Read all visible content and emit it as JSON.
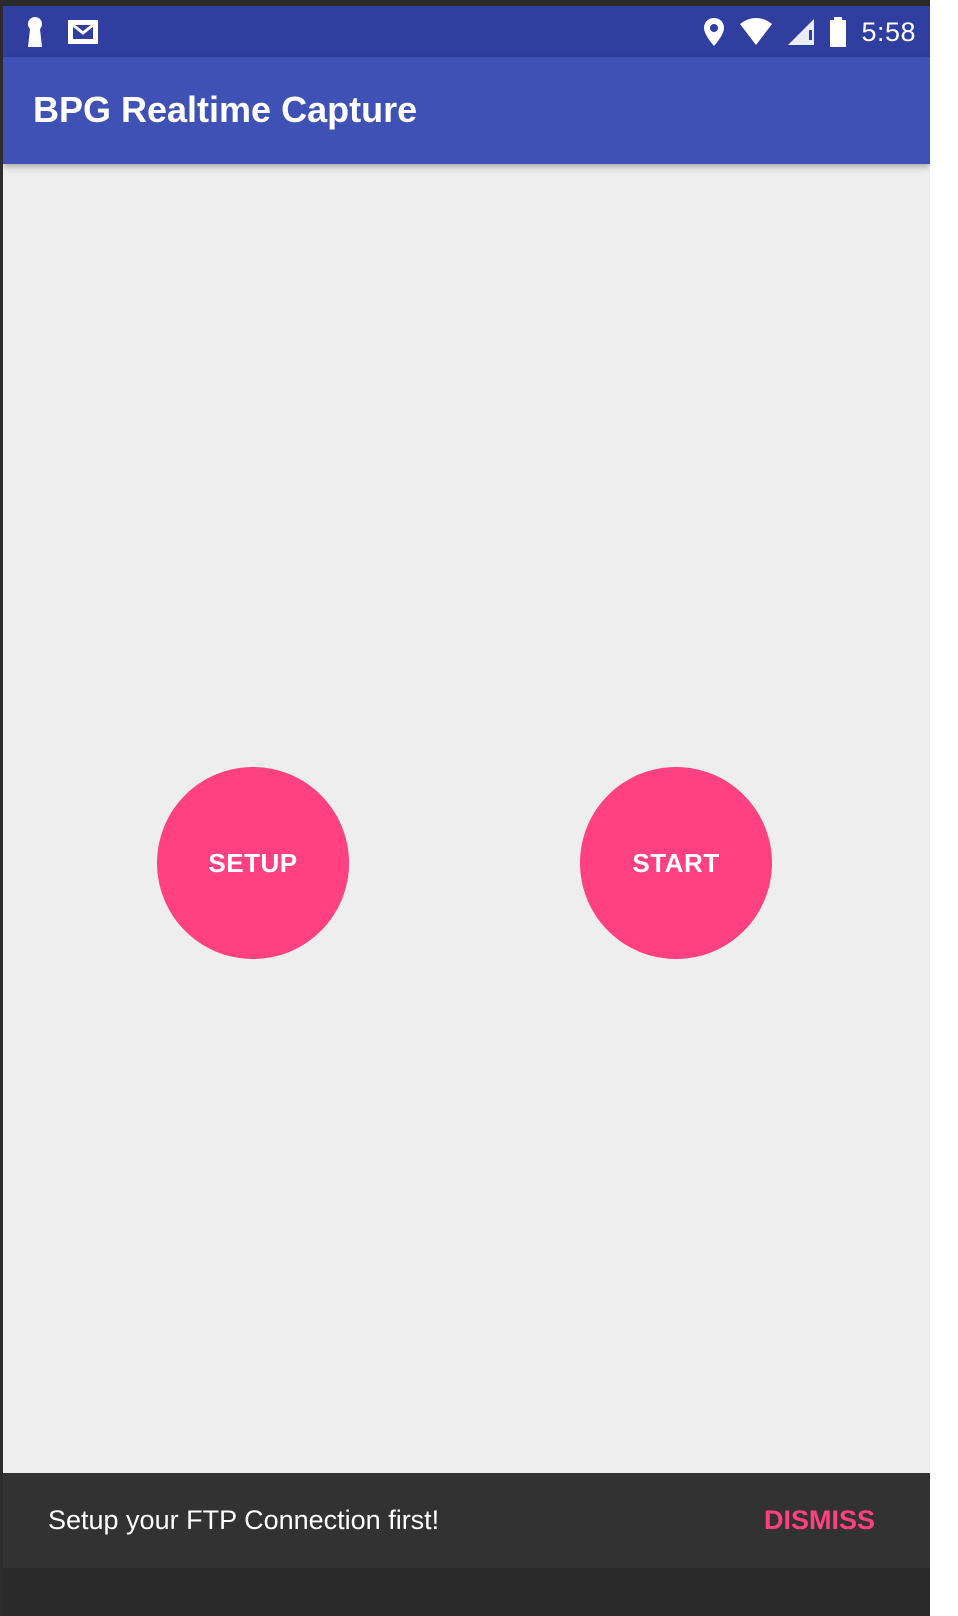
{
  "status_bar": {
    "time": "5:58",
    "left_icons": [
      "notification-keyhole-icon",
      "gmail-icon"
    ],
    "right_icons": [
      "location-pin-icon",
      "wifi-icon",
      "signal-icon",
      "battery-icon"
    ]
  },
  "app_bar": {
    "title": "BPG Realtime Capture"
  },
  "main": {
    "setup_label": "SETUP",
    "start_label": "START"
  },
  "snackbar": {
    "message": "Setup your FTP Connection first!",
    "action": "DISMISS"
  },
  "colors": {
    "status_bar": "#303f9f",
    "primary": "#3f51b5",
    "accent": "#ff4081",
    "background": "#eeeeee",
    "snackbar": "#323232"
  }
}
